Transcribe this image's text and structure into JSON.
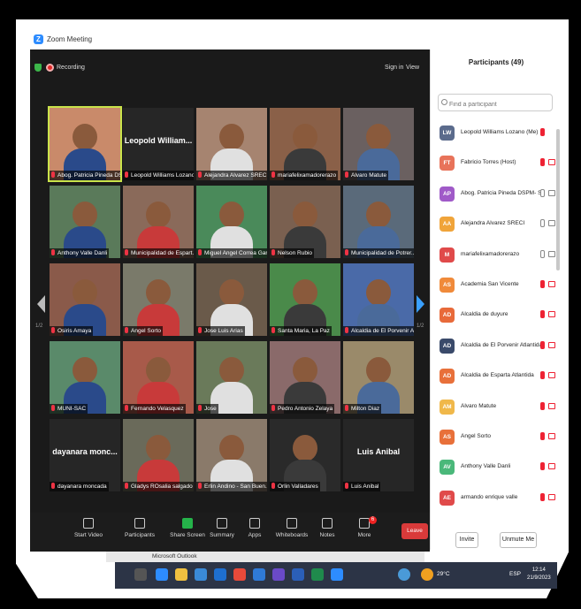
{
  "window": {
    "title": "Zoom Meeting"
  },
  "meeting_bar": {
    "recording": "Recording",
    "sign_in": "Sign in",
    "view": "View"
  },
  "tiles": [
    {
      "label": "Abog. Patricia Pineda DSP...",
      "big": ""
    },
    {
      "label": "Leopold Williams Lozano",
      "big": "Leopold William..."
    },
    {
      "label": "Alejandra Alvarez SRECI",
      "big": ""
    },
    {
      "label": "mariafelixamadorerazo",
      "big": ""
    },
    {
      "label": "Alvaro Matute",
      "big": ""
    },
    {
      "label": "Anthony Valle Danli",
      "big": ""
    },
    {
      "label": "Municipalidad de Espart...",
      "big": ""
    },
    {
      "label": "Miguel Angel Correa Gar...",
      "big": ""
    },
    {
      "label": "Nelson Rubio",
      "big": ""
    },
    {
      "label": "Municipalidad de Potrer...",
      "big": ""
    },
    {
      "label": "Osiris Amaya",
      "big": ""
    },
    {
      "label": "Angel Sorto",
      "big": ""
    },
    {
      "label": "Jose Luis Arias",
      "big": ""
    },
    {
      "label": "Santa Maria, La Paz",
      "big": ""
    },
    {
      "label": "Alcaldia de El Porvenir A...",
      "big": ""
    },
    {
      "label": "MUNI-SAC",
      "big": ""
    },
    {
      "label": "Fernando Velasquez",
      "big": ""
    },
    {
      "label": "Jose",
      "big": ""
    },
    {
      "label": "Pedro Antonio Zelaya",
      "big": ""
    },
    {
      "label": "Milton Diaz",
      "big": ""
    },
    {
      "label": "dayanara moncada",
      "big": "dayanara monc..."
    },
    {
      "label": "Gladys ROsalia salgado",
      "big": ""
    },
    {
      "label": "Erlin Andino - San Buen...",
      "big": ""
    },
    {
      "label": "Orlin Valladares",
      "big": ""
    },
    {
      "label": "Luis Anibal",
      "big": "Luis Anibal"
    }
  ],
  "pager": {
    "left": "1/2",
    "right": "1/2"
  },
  "toolbar": {
    "start_video": "Start Video",
    "participants": "Participants",
    "participants_count": "49",
    "share_screen": "Share Screen",
    "summary": "Summary",
    "apps": "Apps",
    "whiteboards": "Whiteboards",
    "notes": "Notes",
    "more": "More",
    "more_badge": "6",
    "leave": "Leave"
  },
  "participants_panel": {
    "title": "Participants (49)",
    "search_placeholder": "Find a participant",
    "items": [
      {
        "initials": "LW",
        "name": "Leopold Williams Lozano (Me)",
        "color": "#5b6b8c",
        "mic": "off",
        "cam": "none"
      },
      {
        "initials": "FT",
        "name": "Fabricio Torres (Host)",
        "color": "#e8735a",
        "mic": "off",
        "cam": "off"
      },
      {
        "initials": "AP",
        "name": "Abog. Patricia Pineda DSPM- S...",
        "color": "#a05ac8",
        "mic": "on",
        "cam": "on"
      },
      {
        "initials": "AA",
        "name": "Alejandra Alvarez SRECI",
        "color": "#f0a43a",
        "mic": "on",
        "cam": "on"
      },
      {
        "initials": "M",
        "name": "mariafelixamadorerazo",
        "color": "#e04a4a",
        "mic": "on",
        "cam": "on"
      },
      {
        "initials": "AS",
        "name": "Academia San Vicente",
        "color": "#f08a3a",
        "mic": "off",
        "cam": "off"
      },
      {
        "initials": "AD",
        "name": "Alcaldia de duyure",
        "color": "#e86a3a",
        "mic": "off",
        "cam": "off"
      },
      {
        "initials": "AD",
        "name": "Alcaldia de El Porvenir Atlantida",
        "color": "#3a4a6a",
        "mic": "off",
        "cam": "off"
      },
      {
        "initials": "AD",
        "name": "Alcaldia de Esparta Atlantida",
        "color": "#e8703a",
        "mic": "off",
        "cam": "off"
      },
      {
        "initials": "AM",
        "name": "Alvaro Matute",
        "color": "#f0b84a",
        "mic": "off",
        "cam": "off"
      },
      {
        "initials": "AS",
        "name": "Angel Sorto",
        "color": "#e8703a",
        "mic": "off",
        "cam": "off"
      },
      {
        "initials": "AV",
        "name": "Anthony Valle Danli",
        "color": "#4ab87a",
        "mic": "off",
        "cam": "off"
      },
      {
        "initials": "AE",
        "name": "armando enrique valle",
        "color": "#e04a4a",
        "mic": "off",
        "cam": "off"
      }
    ],
    "invite": "Invite",
    "unmute_me": "Unmute Me"
  },
  "taskbar": {
    "outlook": "Microsoft Outlook",
    "weather": "29°C",
    "language": "ESP",
    "time": "12:14",
    "date": "21/9/2023"
  }
}
